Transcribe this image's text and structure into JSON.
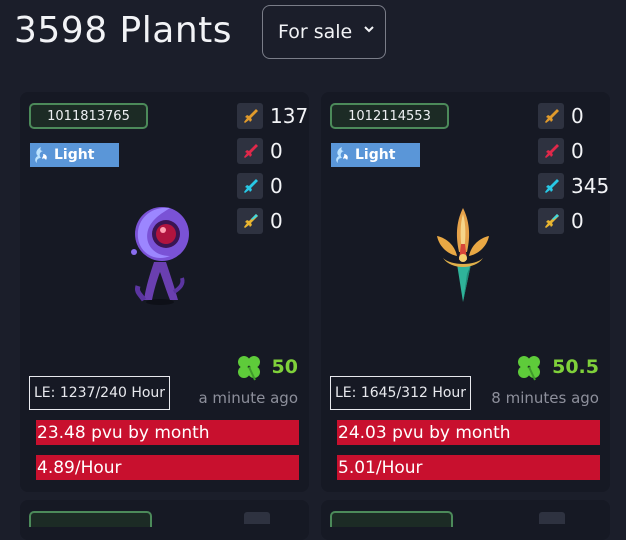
{
  "header": {
    "title": "3598 Plants",
    "filter": "For sale"
  },
  "cards": [
    {
      "id": "1011813765",
      "element": "Light",
      "stats": [
        137,
        0,
        0,
        0
      ],
      "clover": "50",
      "le": "LE: 1237/240 Hour",
      "time_ago": "a minute ago",
      "pvu_month": "23.48 pvu by month",
      "per_hour": "4.89/Hour"
    },
    {
      "id": "1012114553",
      "element": "Light",
      "stats": [
        0,
        0,
        345,
        0
      ],
      "clover": "50.5",
      "le": "LE: 1645/312 Hour",
      "time_ago": "8 minutes ago",
      "pvu_month": "24.03 pvu by month",
      "per_hour": "5.01/Hour"
    }
  ],
  "colors": {
    "background": "#1b1e2a",
    "card": "#161924",
    "element_badge": "#5a96d8",
    "earnings_bar": "#c8102e",
    "clover_green": "#7fd03a"
  },
  "icons": {
    "filter_chevron": "chevron-down-icon",
    "element": "light-element-icon",
    "stat_tiles": [
      "orange-sword-icon",
      "red-sword-icon",
      "cyan-sword-icon",
      "yellow-cyan-sword-icon"
    ],
    "clover": "four-leaf-clover-icon"
  }
}
